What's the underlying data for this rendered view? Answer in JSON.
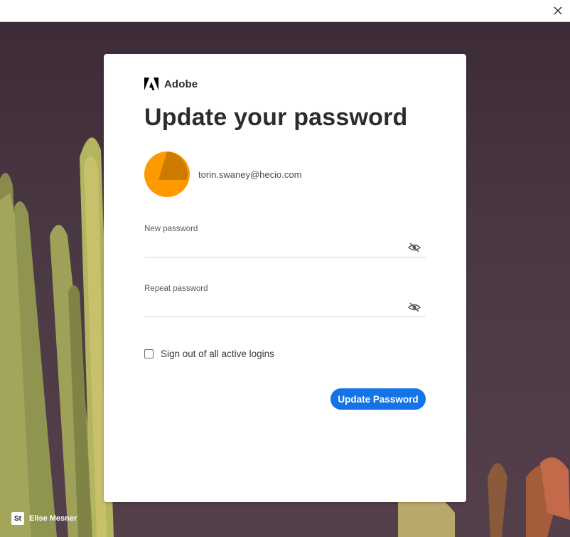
{
  "window": {
    "close_icon": "close-icon"
  },
  "brand": {
    "name": "Adobe",
    "logo_icon": "adobe-logo",
    "logo_color": "#000000"
  },
  "page": {
    "title": "Update your password"
  },
  "account": {
    "email": "torin.swaney@hecio.com",
    "avatar_color": "#ff9900",
    "avatar_shade": "#cc7a00"
  },
  "form": {
    "new_password": {
      "label": "New password",
      "value": "",
      "toggle_icon": "eye-hidden-icon"
    },
    "repeat_password": {
      "label": "Repeat password",
      "value": "",
      "toggle_icon": "eye-hidden-icon"
    },
    "sign_out_all": {
      "label": "Sign out of all active logins",
      "checked": false
    },
    "submit_label": "Update Password",
    "submit_color": "#1473e6"
  },
  "background_credit": {
    "badge": "St",
    "name": "Elise Mesner"
  }
}
